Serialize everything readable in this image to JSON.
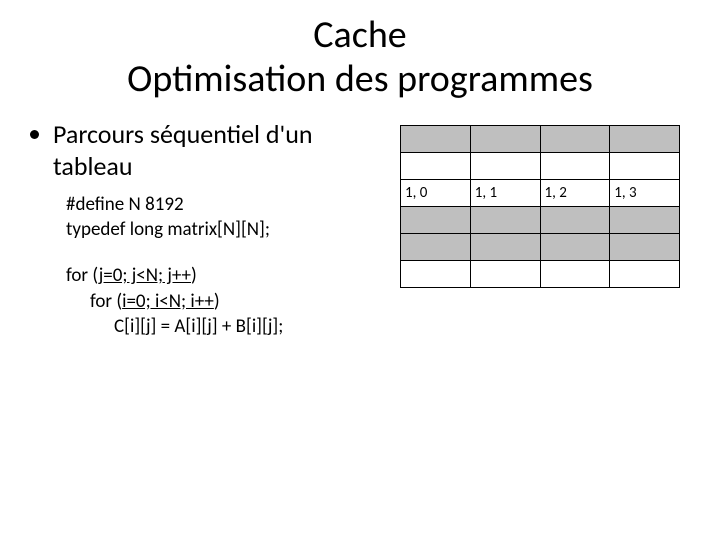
{
  "title_line1": "Cache",
  "title_line2": "Optimisation des programmes",
  "bullet1": "Parcours séquentiel d'un tableau",
  "code": {
    "l1": "#define N 8192",
    "l2": "typedef long matrix[N][N];",
    "l3_pre": "for (",
    "l3_u": "j=0; j<N; j++",
    "l3_post": ")",
    "l4_pre": "for (",
    "l4_u": "i=0; i<N; i++",
    "l4_post": ")",
    "l5": "C[i][j] = A[i][j] + B[i][j];"
  },
  "matrix": {
    "rows": [
      [
        "",
        "",
        "",
        ""
      ],
      [
        "",
        "",
        "",
        ""
      ],
      [
        "1, 0",
        "1, 1",
        "1, 2",
        "1, 3"
      ],
      [
        "",
        "",
        "",
        ""
      ],
      [
        "",
        "",
        "",
        ""
      ],
      [
        "",
        "",
        "",
        ""
      ]
    ],
    "shaded_row_indices": [
      0,
      3,
      4
    ]
  }
}
